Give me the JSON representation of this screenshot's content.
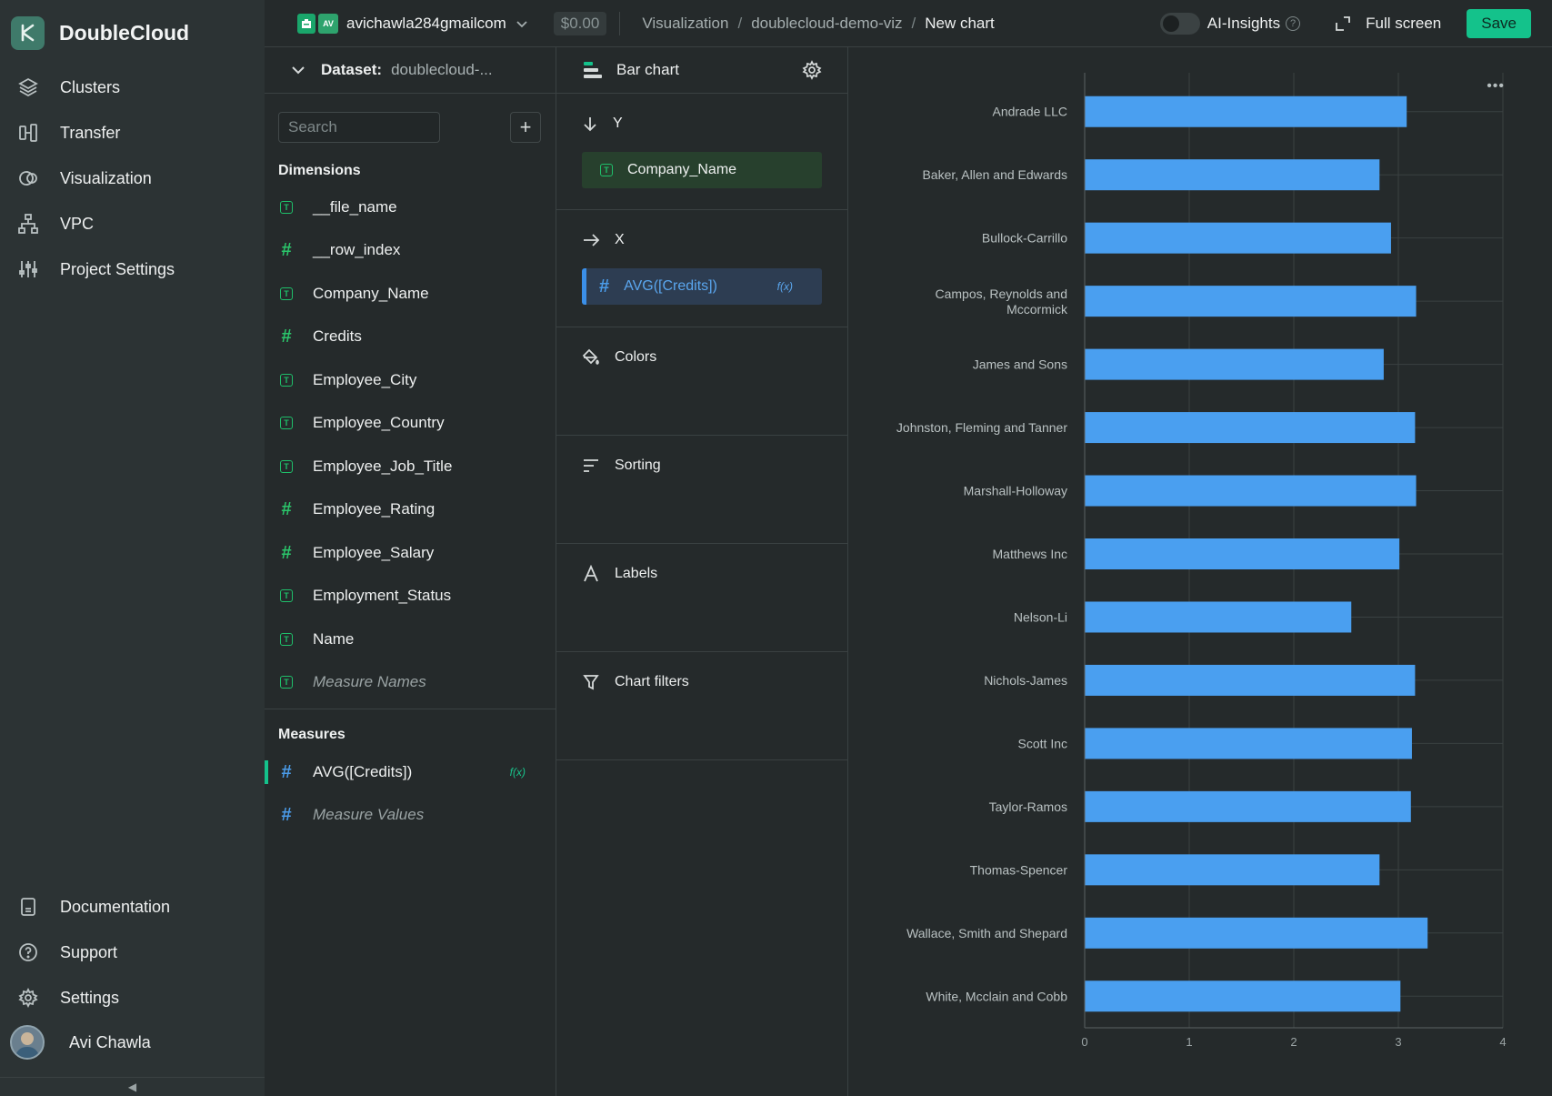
{
  "app": {
    "name": "DoubleCloud"
  },
  "sidebar": {
    "items": [
      {
        "label": "Clusters",
        "icon": "layers-icon"
      },
      {
        "label": "Transfer",
        "icon": "transfer-icon"
      },
      {
        "label": "Visualization",
        "icon": "visualization-icon"
      },
      {
        "label": "VPC",
        "icon": "network-icon"
      },
      {
        "label": "Project Settings",
        "icon": "sliders-icon"
      }
    ],
    "bottom_items": [
      {
        "label": "Documentation",
        "icon": "book-icon"
      },
      {
        "label": "Support",
        "icon": "help-circle-icon"
      },
      {
        "label": "Settings",
        "icon": "gear-icon"
      }
    ],
    "user": {
      "name": "Avi Chawla"
    }
  },
  "header": {
    "account_badge": "AV",
    "account": "avichawla284gmailcom",
    "balance": "$0.00",
    "breadcrumbs": [
      "Visualization",
      "doublecloud-demo-viz",
      "New chart"
    ],
    "ai_insights": "AI-Insights",
    "fullscreen": "Full screen",
    "save": "Save"
  },
  "dataset": {
    "label": "Dataset:",
    "name": "doublecloud-...",
    "search_placeholder": "Search",
    "dimensions_title": "Dimensions",
    "dimensions": [
      {
        "name": "__file_name",
        "type": "text"
      },
      {
        "name": "__row_index",
        "type": "number"
      },
      {
        "name": "Company_Name",
        "type": "text"
      },
      {
        "name": "Credits",
        "type": "number"
      },
      {
        "name": "Employee_City",
        "type": "text"
      },
      {
        "name": "Employee_Country",
        "type": "text"
      },
      {
        "name": "Employee_Job_Title",
        "type": "text"
      },
      {
        "name": "Employee_Rating",
        "type": "number"
      },
      {
        "name": "Employee_Salary",
        "type": "number"
      },
      {
        "name": "Employment_Status",
        "type": "text"
      },
      {
        "name": "Name",
        "type": "text"
      },
      {
        "name": "Measure Names",
        "type": "text"
      }
    ],
    "measures_title": "Measures",
    "measures": [
      {
        "name": "AVG([Credits])",
        "badge": "f(x)"
      },
      {
        "name": "Measure Values"
      }
    ]
  },
  "config": {
    "chart_type": "Bar chart",
    "y_label": "Y",
    "y_field": "Company_Name",
    "x_label": "X",
    "x_field": "AVG([Credits])",
    "x_badge": "f(x)",
    "sections": [
      "Colors",
      "Sorting",
      "Labels",
      "Chart filters"
    ]
  },
  "chart_data": {
    "type": "bar",
    "orientation": "horizontal",
    "categories": [
      "Andrade LLC",
      "Baker, Allen and Edwards",
      "Bullock-Carrillo",
      "Campos, Reynolds and Mccormick",
      "James and Sons",
      "Johnston, Fleming and Tanner",
      "Marshall-Holloway",
      "Matthews Inc",
      "Nelson-Li",
      "Nichols-James",
      "Scott Inc",
      "Taylor-Ramos",
      "Thomas-Spencer",
      "Wallace, Smith and Shepard",
      "White, Mcclain and Cobb"
    ],
    "values": [
      3.08,
      2.82,
      2.93,
      3.17,
      2.86,
      3.16,
      3.17,
      3.01,
      2.55,
      3.16,
      3.13,
      3.12,
      2.82,
      3.28,
      3.02
    ],
    "xlim": [
      0,
      4
    ],
    "xticks": [
      "0",
      "1",
      "2",
      "3",
      "4"
    ],
    "bar_color": "#4a9ff0",
    "grid": true
  },
  "colors": {
    "accent": "#14c28b",
    "bar": "#4a9ff0"
  }
}
